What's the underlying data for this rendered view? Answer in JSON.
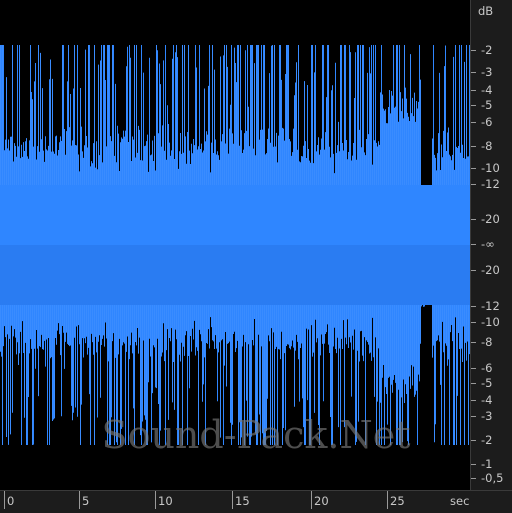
{
  "watermark": "Sound-Pack.Net",
  "colors": {
    "waveform": "#2f86ff",
    "waveform_dark": "#1f6fe0",
    "background": "#000000",
    "ruler_bg": "#1c1c1c",
    "ruler_text": "#c8c8c8"
  },
  "db_ruler": {
    "unit": "dB",
    "labels": [
      "-2",
      "-3",
      "-4",
      "-5",
      "-6",
      "-8",
      "-10",
      "-12",
      "-20",
      "-∞",
      "-20",
      "-12",
      "-10",
      "-8",
      "-6",
      "-5",
      "-4",
      "-3",
      "-2",
      "-1",
      "-0,5"
    ]
  },
  "time_ruler": {
    "unit": "sec",
    "labels": [
      "0",
      "5",
      "10",
      "15",
      "20",
      "25"
    ]
  }
}
